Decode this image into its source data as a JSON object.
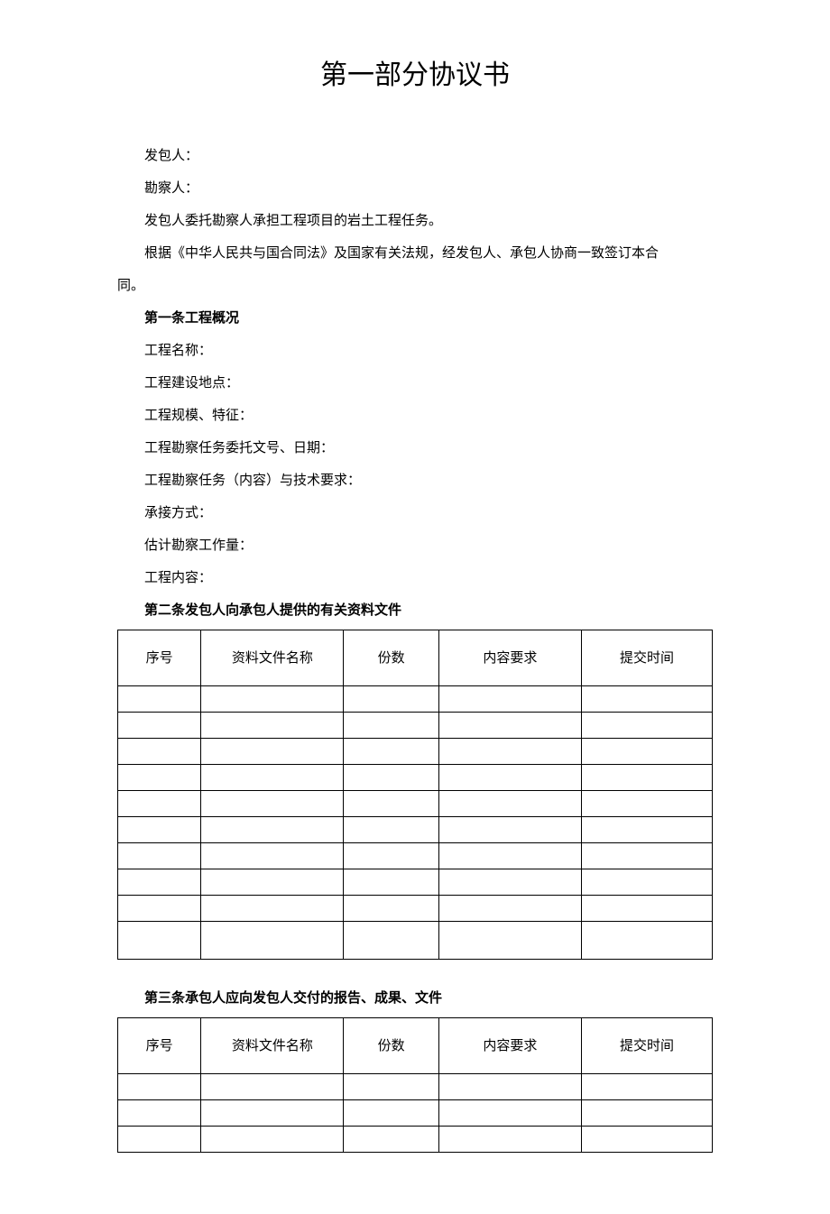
{
  "title": "第一部分协议书",
  "intro": {
    "line1": "发包人：",
    "line2": "勘察人：",
    "line3": "发包人委托勘察人承担工程项目的岩土工程任务。",
    "line4_a": "根据《中华人民共与国合同法》及国家有关法规，经发包人、承包人协商一致签订本合",
    "line4_b": "同。"
  },
  "article1": {
    "heading": "第一条工程概况",
    "items": [
      "工程名称：",
      "工程建设地点：",
      "工程规模、特征：",
      "工程勘察任务委托文号、日期：",
      "工程勘察任务（内容）与技术要求：",
      "承接方式：",
      "估计勘察工作量：",
      "工程内容："
    ]
  },
  "article2": {
    "heading": "第二条发包人向承包人提供的有关资料文件",
    "headers": [
      "序号",
      "资料文件名称",
      "份数",
      "内容要求",
      "提交时间"
    ],
    "rows": [
      [
        "",
        "",
        "",
        "",
        ""
      ],
      [
        "",
        "",
        "",
        "",
        ""
      ],
      [
        "",
        "",
        "",
        "",
        ""
      ],
      [
        "",
        "",
        "",
        "",
        ""
      ],
      [
        "",
        "",
        "",
        "",
        ""
      ],
      [
        "",
        "",
        "",
        "",
        ""
      ],
      [
        "",
        "",
        "",
        "",
        ""
      ],
      [
        "",
        "",
        "",
        "",
        ""
      ],
      [
        "",
        "",
        "",
        "",
        ""
      ],
      [
        "",
        "",
        "",
        "",
        ""
      ]
    ]
  },
  "article3": {
    "heading": "第三条承包人应向发包人交付的报告、成果、文件",
    "headers": [
      "序号",
      "资料文件名称",
      "份数",
      "内容要求",
      "提交时间"
    ],
    "rows": [
      [
        "",
        "",
        "",
        "",
        ""
      ],
      [
        "",
        "",
        "",
        "",
        ""
      ],
      [
        "",
        "",
        "",
        "",
        ""
      ]
    ]
  }
}
